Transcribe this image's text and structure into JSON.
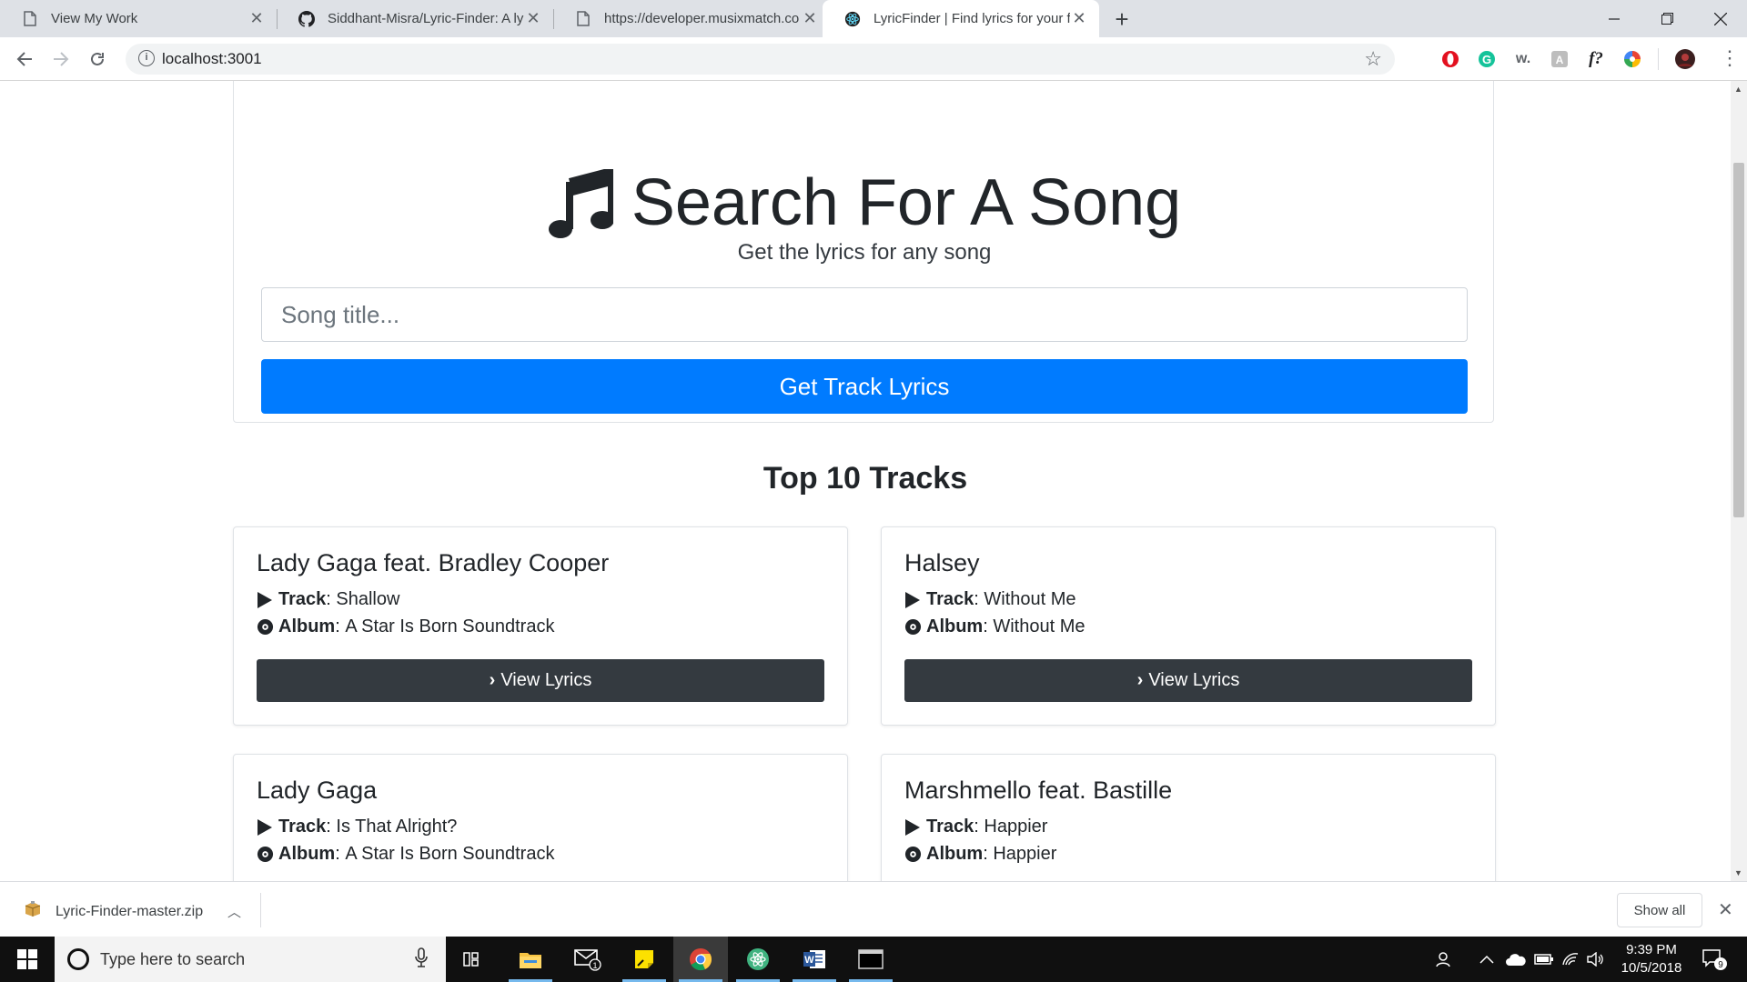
{
  "browser": {
    "tabs": [
      {
        "title": "View My Work",
        "icon": "page-icon",
        "active": false
      },
      {
        "title": "Siddhant-Misra/Lyric-Finder: A ly",
        "icon": "github-icon",
        "active": false
      },
      {
        "title": "https://developer.musixmatch.co",
        "icon": "page-icon",
        "active": false
      },
      {
        "title": "LyricFinder | Find lyrics for your fa",
        "icon": "react-icon",
        "active": true
      }
    ],
    "new_tab_symbol": "+",
    "address": "localhost:3001",
    "extensions": [
      "opera-icon",
      "grammarly-icon",
      "wordtune-icon",
      "translate-icon",
      "formula-icon",
      "color-wheel-icon",
      "profile-avatar"
    ]
  },
  "page": {
    "hero": {
      "title": "Search For A Song",
      "subtitle": "Get the lyrics for any song",
      "input_placeholder": "Song title...",
      "button_label": "Get Track Lyrics"
    },
    "section_title": "Top 10 Tracks",
    "track_label": "Track",
    "album_label": "Album",
    "view_lyrics_label": "View Lyrics",
    "tracks": [
      {
        "artist": "Lady Gaga feat. Bradley Cooper",
        "track": "Shallow",
        "album": "A Star Is Born Soundtrack"
      },
      {
        "artist": "Halsey",
        "track": "Without Me",
        "album": "Without Me"
      },
      {
        "artist": "Lady Gaga",
        "track": "Is That Alright?",
        "album": "A Star Is Born Soundtrack"
      },
      {
        "artist": "Marshmello feat. Bastille",
        "track": "Happier",
        "album": "Happier"
      }
    ]
  },
  "download_shelf": {
    "filename": "Lyric-Finder-master.zip",
    "show_all_label": "Show all"
  },
  "taskbar": {
    "search_placeholder": "Type here to search",
    "time": "9:39 PM",
    "date": "10/5/2018",
    "mail_badge": "1",
    "notification_count": "9"
  },
  "colors": {
    "primary": "#007bff",
    "dark_button": "#343a40"
  }
}
